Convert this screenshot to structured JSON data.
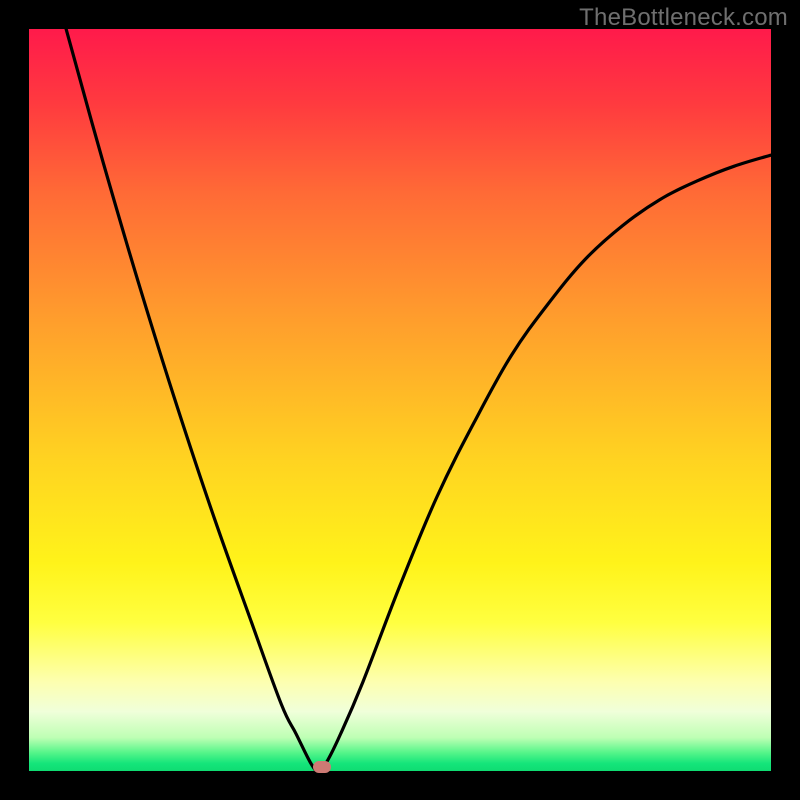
{
  "watermark": "TheBottleneck.com",
  "colors": {
    "frame": "#000000",
    "gradient_top": "#ff1a4b",
    "gradient_mid": "#ffd321",
    "gradient_bottom": "#14e57a",
    "curve": "#000000",
    "dot": "#cd7a74"
  },
  "chart_data": {
    "type": "line",
    "title": "",
    "xlabel": "",
    "ylabel": "",
    "xlim": [
      0,
      100
    ],
    "ylim": [
      0,
      100
    ],
    "notch": {
      "x": 39,
      "y": 0
    },
    "series": [
      {
        "name": "curve",
        "x": [
          5,
          10,
          15,
          20,
          25,
          30,
          34,
          36,
          38,
          39,
          40,
          42,
          45,
          50,
          55,
          60,
          65,
          70,
          75,
          80,
          85,
          90,
          95,
          100
        ],
        "values": [
          100,
          82,
          65,
          49,
          34,
          20,
          9,
          5,
          1,
          0,
          1,
          5,
          12,
          25,
          37,
          47,
          56,
          63,
          69,
          73.5,
          77,
          79.5,
          81.5,
          83
        ]
      }
    ],
    "marker": {
      "x": 39.5,
      "y": 0.5
    }
  }
}
